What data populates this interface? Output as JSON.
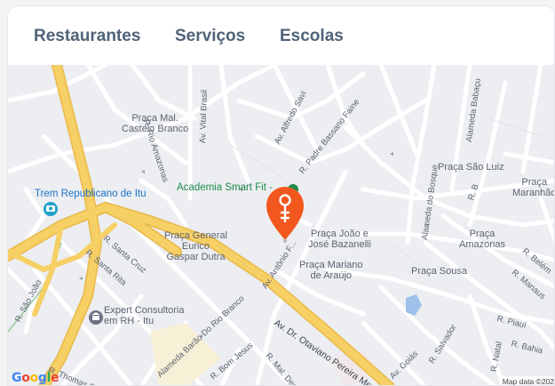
{
  "tabs": [
    {
      "label": "Restaurantes"
    },
    {
      "label": "Serviços"
    },
    {
      "label": "Escolas"
    }
  ],
  "map": {
    "places": {
      "praca_castelo": "Praça Mal.\nCastelo Branco",
      "trem": "Trem Republicano de Itu",
      "academia": "Academia Smart Fit -",
      "praca_eurico": "Praça General\nEurico\nGaspar Dutra",
      "praca_bazanelli": "Praça João e\nJosé Bazanelli",
      "praca_mariano": "Praça Mariano\nde Araújo",
      "praca_sao_luiz": "Praça São Luiz",
      "praca_maranhao": "Praça\nMaranhão",
      "praca_amazonas": "Praça\nAmazonas",
      "praca_sousa": "Praça Sousa",
      "expert": "Expert Consultoria\nem RH - Itu"
    },
    "streets": {
      "vital_brasil": "Av. Vital Brasil",
      "alfredo_savi": "Av. Alfredo Savi",
      "bassano": "R. Padre Bassano Faine",
      "babacu": "Alameda Babaçu",
      "rio_amazonas": "R. Rio Amazonas",
      "bosque": "Alameda do Bosque",
      "r_b": "R. B",
      "santa_cruz": "R. Santa Cruz",
      "santa_rita": "R. Santa Rita",
      "sao_joao": "R. São João",
      "antonio": "Av. Antônio F...",
      "belem": "R. Belém",
      "manaus": "R. Manaus",
      "piaui": "R. Piauí",
      "bahia": "R. Bahia",
      "salvador": "R. Salvador",
      "natal": "R. Natal",
      "goias": "Av. Goiás",
      "otaviano": "Av. Dr. Otaviano Pereira Mendes",
      "barao": "Alameda Barão Do Rio Branco",
      "bom_jesus": "R. Bom Jesus",
      "deodoro": "R. Mal. Deodoro",
      "thomas": "R. Thomas Simon"
    },
    "google_logo": "Google",
    "map_data": "Map data ©202"
  },
  "colors": {
    "tab_text": "#4f6378",
    "highway": "#f6cf65",
    "marker": "#f2581e",
    "park": "#1f8a4c"
  }
}
